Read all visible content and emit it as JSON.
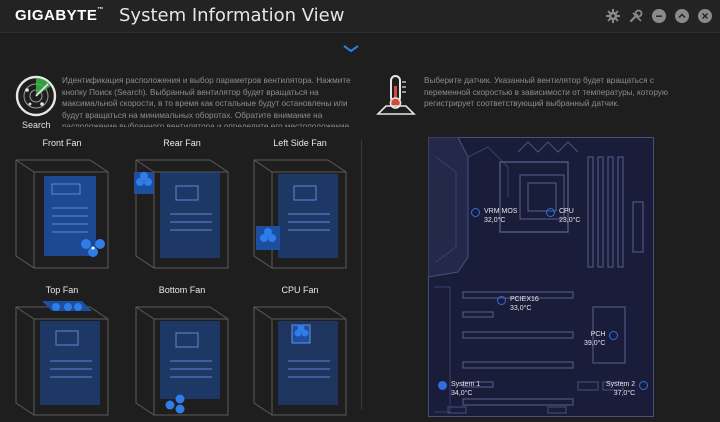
{
  "window": {
    "brand": "GIGABYTE",
    "title": "System Information View"
  },
  "search": {
    "label": "Search",
    "description": "Идентификация расположения и выбор параметров вентилятора. Нажмите кнопку Поиск (Search). Выбранный вентилятор будет вращаться на максимальной скорости, в то время как остальные будут остановлены или будут вращаться на минимальных оборотах. Обратите внимание на расположение выбранного вентилятора и определите его местоположение."
  },
  "fans": [
    {
      "label": "Front Fan"
    },
    {
      "label": "Rear Fan"
    },
    {
      "label": "Left Side Fan"
    },
    {
      "label": "Top Fan"
    },
    {
      "label": "Bottom Fan"
    },
    {
      "label": "CPU Fan"
    }
  ],
  "sensor_info": {
    "description": "Выберите датчик.  Указанный вентилятор будет вращаться с переменной скоростью в зависимости от температуры, которую регистрирует соответствующий выбранный датчик."
  },
  "sensors": [
    {
      "name": "VRM MOS",
      "value": "32,0°C"
    },
    {
      "name": "CPU",
      "value": "23,0°C"
    },
    {
      "name": "PCIEX16",
      "value": "33,0°C"
    },
    {
      "name": "PCH",
      "value": "39,0°C"
    },
    {
      "name": "System 1",
      "value": "34,0°C"
    },
    {
      "name": "System 2",
      "value": "37,0°C"
    }
  ],
  "colors": {
    "accent": "#2f6fe0",
    "background": "#1e1e1e",
    "board": "#1a1d3a"
  }
}
